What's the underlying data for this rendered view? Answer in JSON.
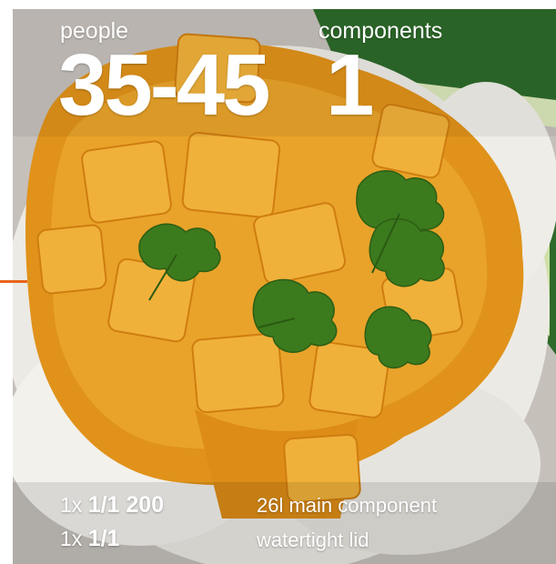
{
  "stats": {
    "people_label": "people",
    "people_value": "35-45",
    "components_label": "components",
    "components_value": "1"
  },
  "specs": [
    {
      "qty": "1x",
      "size": "1/1 200",
      "description": "26l main component"
    },
    {
      "qty": "1x",
      "size": "1/1",
      "description": "watertight lid"
    }
  ],
  "photo": {
    "subject": "curry-with-rice-and-cilantro",
    "colors": {
      "curry": "#e59a1c",
      "rice": "#ecebe6",
      "cucumber": "#2f6b2a",
      "cilantro": "#3f7d1e",
      "plate": "#c9c4bd"
    }
  },
  "accent_color": "#e8641b"
}
